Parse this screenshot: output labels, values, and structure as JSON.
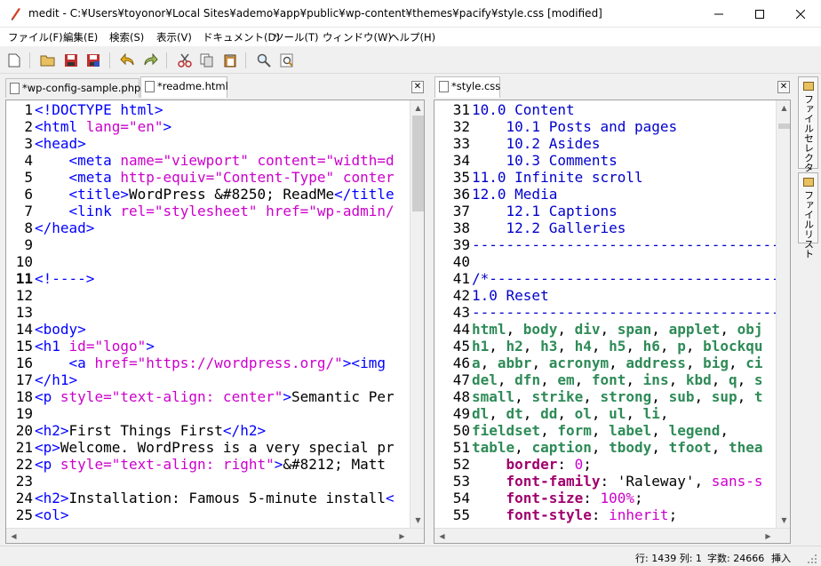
{
  "window": {
    "title": "medit - C:¥Users¥toyonor¥Local Sites¥ademo¥app¥public¥wp-content¥themes¥pacify¥style.css [modified]"
  },
  "menu": [
    "ファイル(F)",
    "編集(E)",
    "検索(S)",
    "表示(V)",
    "ドキュメント(D)",
    "ツール(T)",
    "ウィンドウ(W)",
    "ヘルプ(H)"
  ],
  "toolbar": [
    "new-file",
    "open",
    "save",
    "save-all",
    "undo",
    "redo",
    "cut",
    "copy",
    "paste",
    "find",
    "replace"
  ],
  "left_pane": {
    "tabs": [
      {
        "label": "*wp-config-sample.php",
        "active": false
      },
      {
        "label": "*readme.html",
        "active": true
      }
    ],
    "current_line": "11",
    "lines": [
      {
        "n": "1",
        "html": "<span class='t-tag'>&lt;!DOCTYPE html&gt;</span>"
      },
      {
        "n": "2",
        "html": "<span class='t-tag'>&lt;html</span> <span class='t-attr'>lang=</span><span class='t-str'>\"en\"</span><span class='t-tag'>&gt;</span>"
      },
      {
        "n": "3",
        "html": "<span class='t-tag'>&lt;head&gt;</span>"
      },
      {
        "n": "4",
        "html": "    <span class='t-tag'>&lt;meta</span> <span class='t-attr'>name=</span><span class='t-str'>\"viewport\"</span> <span class='t-attr'>content=</span><span class='t-str'>\"width=d</span>"
      },
      {
        "n": "5",
        "html": "    <span class='t-tag'>&lt;meta</span> <span class='t-attr'>http-equiv=</span><span class='t-str'>\"Content-Type\"</span> <span class='t-attr'>conter</span>"
      },
      {
        "n": "6",
        "html": "    <span class='t-tag'>&lt;title&gt;</span>WordPress &amp;#8250; ReadMe<span class='t-tag'>&lt;/title</span>"
      },
      {
        "n": "7",
        "html": "    <span class='t-tag'>&lt;link</span> <span class='t-attr'>rel=</span><span class='t-str'>\"stylesheet\"</span> <span class='t-attr'>href=</span><span class='t-str'>\"wp-admin/</span>"
      },
      {
        "n": "8",
        "html": "<span class='t-tag'>&lt;/head&gt;</span>"
      },
      {
        "n": "9",
        "html": ""
      },
      {
        "n": "10",
        "html": ""
      },
      {
        "n": "11",
        "html": "<span class='t-tag'>&lt;!----&gt;</span>"
      },
      {
        "n": "12",
        "html": ""
      },
      {
        "n": "13",
        "html": ""
      },
      {
        "n": "14",
        "html": "<span class='t-tag'>&lt;body&gt;</span>"
      },
      {
        "n": "15",
        "html": "<span class='t-tag'>&lt;h1</span> <span class='t-attr'>id=</span><span class='t-str'>\"logo\"</span><span class='t-tag'>&gt;</span>"
      },
      {
        "n": "16",
        "html": "    <span class='t-tag'>&lt;a</span> <span class='t-attr'>href=</span><span class='t-str'>\"https://wordpress.org/\"</span><span class='t-tag'>&gt;&lt;img</span>"
      },
      {
        "n": "17",
        "html": "<span class='t-tag'>&lt;/h1&gt;</span>"
      },
      {
        "n": "18",
        "html": "<span class='t-tag'>&lt;p</span> <span class='t-attr'>style=</span><span class='t-str'>\"text-align: center\"</span><span class='t-tag'>&gt;</span>Semantic Per"
      },
      {
        "n": "19",
        "html": ""
      },
      {
        "n": "20",
        "html": "<span class='t-tag'>&lt;h2&gt;</span>First Things First<span class='t-tag'>&lt;/h2&gt;</span>"
      },
      {
        "n": "21",
        "html": "<span class='t-tag'>&lt;p&gt;</span>Welcome. WordPress is a very special pr"
      },
      {
        "n": "22",
        "html": "<span class='t-tag'>&lt;p</span> <span class='t-attr'>style=</span><span class='t-str'>\"text-align: right\"</span><span class='t-tag'>&gt;</span>&amp;#8212; Matt"
      },
      {
        "n": "23",
        "html": ""
      },
      {
        "n": "24",
        "html": "<span class='t-tag'>&lt;h2&gt;</span>Installation: Famous 5-minute install<span class='t-tag'>&lt;</span>"
      },
      {
        "n": "25",
        "html": "<span class='t-tag'>&lt;ol&gt;</span>"
      }
    ]
  },
  "right_pane": {
    "tabs": [
      {
        "label": "*style.css",
        "active": true
      }
    ],
    "lines": [
      {
        "n": "31",
        "html": "<span class='t-blue'>10.0 Content</span>"
      },
      {
        "n": "32",
        "html": "<span class='t-blue'>    10.1 Posts and pages</span>"
      },
      {
        "n": "33",
        "html": "<span class='t-blue'>    10.2 Asides</span>"
      },
      {
        "n": "34",
        "html": "<span class='t-blue'>    10.3 Comments</span>"
      },
      {
        "n": "35",
        "html": "<span class='t-blue'>11.0 Infinite scroll</span>"
      },
      {
        "n": "36",
        "html": "<span class='t-blue'>12.0 Media</span>"
      },
      {
        "n": "37",
        "html": "<span class='t-blue'>    12.1 Captions</span>"
      },
      {
        "n": "38",
        "html": "<span class='t-blue'>    12.2 Galleries</span>"
      },
      {
        "n": "39",
        "html": "<span class='t-blue'>--------------------------------------</span>"
      },
      {
        "n": "40",
        "html": ""
      },
      {
        "n": "41",
        "html": "<span class='t-blue'>/*------------------------------------</span>"
      },
      {
        "n": "42",
        "html": "<span class='t-blue'>1.0 Reset</span>"
      },
      {
        "n": "43",
        "html": "<span class='t-blue'>--------------------------------------</span>"
      },
      {
        "n": "44",
        "html": "<span class='t-sel'>html</span>, <span class='t-sel'>body</span>, <span class='t-sel'>div</span>, <span class='t-sel'>span</span>, <span class='t-sel'>applet</span>, <span class='t-sel'>obj</span>"
      },
      {
        "n": "45",
        "html": "<span class='t-sel'>h1</span>, <span class='t-sel'>h2</span>, <span class='t-sel'>h3</span>, <span class='t-sel'>h4</span>, <span class='t-sel'>h5</span>, <span class='t-sel'>h6</span>, <span class='t-sel'>p</span>, <span class='t-sel'>blockqu</span>"
      },
      {
        "n": "46",
        "html": "<span class='t-sel'>a</span>, <span class='t-sel'>abbr</span>, <span class='t-sel'>acronym</span>, <span class='t-sel'>address</span>, <span class='t-sel'>big</span>, <span class='t-sel'>ci</span>"
      },
      {
        "n": "47",
        "html": "<span class='t-sel'>del</span>, <span class='t-sel'>dfn</span>, <span class='t-sel'>em</span>, <span class='t-sel'>font</span>, <span class='t-sel'>ins</span>, <span class='t-sel'>kbd</span>, <span class='t-sel'>q</span>, <span class='t-sel'>s</span>"
      },
      {
        "n": "48",
        "html": "<span class='t-sel'>small</span>, <span class='t-sel'>strike</span>, <span class='t-sel'>strong</span>, <span class='t-sel'>sub</span>, <span class='t-sel'>sup</span>, <span class='t-sel'>t</span>"
      },
      {
        "n": "49",
        "html": "<span class='t-sel'>dl</span>, <span class='t-sel'>dt</span>, <span class='t-sel'>dd</span>, <span class='t-sel'>ol</span>, <span class='t-sel'>ul</span>, <span class='t-sel'>li</span>,"
      },
      {
        "n": "50",
        "html": "<span class='t-sel'>fieldset</span>, <span class='t-sel'>form</span>, <span class='t-sel'>label</span>, <span class='t-sel'>legend</span>,"
      },
      {
        "n": "51",
        "html": "<span class='t-sel'>table</span>, <span class='t-sel'>caption</span>, <span class='t-sel'>tbody</span>, <span class='t-sel'>tfoot</span>, <span class='t-sel'>thea</span>"
      },
      {
        "n": "52",
        "html": "    <span class='t-prop'>border</span>: <span class='t-val'>0</span>;"
      },
      {
        "n": "53",
        "html": "    <span class='t-prop'>font-family</span>: 'Raleway', <span class='t-val'>sans-s</span>"
      },
      {
        "n": "54",
        "html": "    <span class='t-prop'>font-size</span>: <span class='t-val'>100%</span>;"
      },
      {
        "n": "55",
        "html": "    <span class='t-prop'>font-style</span>: <span class='t-val'>inherit</span>;"
      }
    ]
  },
  "side_tabs": [
    "ファイルセレクター",
    "ファイルリスト"
  ],
  "status": {
    "position": "行: 1439 列: 1",
    "chars": "字数: 24666",
    "mode": "挿入"
  },
  "colors": {
    "tag": "#0000ff",
    "attr": "#cc00cc",
    "selector": "#2e8b57",
    "property": "#a0006e",
    "comment": "#0000cc"
  }
}
